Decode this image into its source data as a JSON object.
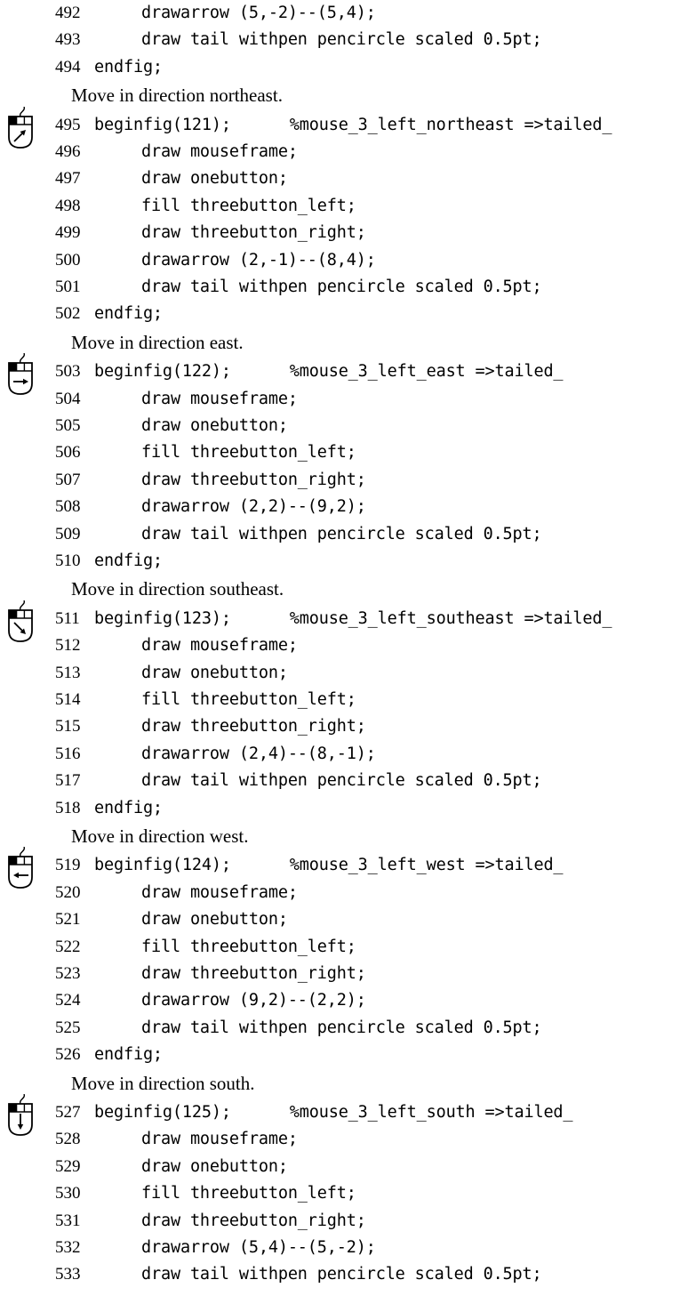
{
  "lead_lines": [
    {
      "num": "492",
      "text": "drawarrow (5,-2)--(5,4);",
      "indent": true
    },
    {
      "num": "493",
      "text": "draw tail withpen pencircle scaled 0.5pt;",
      "indent": true
    },
    {
      "num": "494",
      "text": "endfig;",
      "indent": false
    }
  ],
  "blocks": [
    {
      "caption": "Move in direction northeast.",
      "icon": "mouse-left-button-northeast-arrow-icon",
      "lines": [
        {
          "num": "495",
          "text": "beginfig(121);      %mouse_3_left_northeast =>tailed_",
          "indent": false
        },
        {
          "num": "496",
          "text": "draw mouseframe;",
          "indent": true
        },
        {
          "num": "497",
          "text": "draw onebutton;",
          "indent": true
        },
        {
          "num": "498",
          "text": "fill threebutton_left;",
          "indent": true
        },
        {
          "num": "499",
          "text": "draw threebutton_right;",
          "indent": true
        },
        {
          "num": "500",
          "text": "drawarrow (2,-1)--(8,4);",
          "indent": true
        },
        {
          "num": "501",
          "text": "draw tail withpen pencircle scaled 0.5pt;",
          "indent": true
        },
        {
          "num": "502",
          "text": "endfig;",
          "indent": false
        }
      ]
    },
    {
      "caption": "Move in direction east.",
      "icon": "mouse-left-button-east-arrow-icon",
      "lines": [
        {
          "num": "503",
          "text": "beginfig(122);      %mouse_3_left_east =>tailed_",
          "indent": false
        },
        {
          "num": "504",
          "text": "draw mouseframe;",
          "indent": true
        },
        {
          "num": "505",
          "text": "draw onebutton;",
          "indent": true
        },
        {
          "num": "506",
          "text": "fill threebutton_left;",
          "indent": true
        },
        {
          "num": "507",
          "text": "draw threebutton_right;",
          "indent": true
        },
        {
          "num": "508",
          "text": "drawarrow (2,2)--(9,2);",
          "indent": true
        },
        {
          "num": "509",
          "text": "draw tail withpen pencircle scaled 0.5pt;",
          "indent": true
        },
        {
          "num": "510",
          "text": "endfig;",
          "indent": false
        }
      ]
    },
    {
      "caption": "Move in direction southeast.",
      "icon": "mouse-left-button-southeast-arrow-icon",
      "lines": [
        {
          "num": "511",
          "text": "beginfig(123);      %mouse_3_left_southeast =>tailed_",
          "indent": false
        },
        {
          "num": "512",
          "text": "draw mouseframe;",
          "indent": true
        },
        {
          "num": "513",
          "text": "draw onebutton;",
          "indent": true
        },
        {
          "num": "514",
          "text": "fill threebutton_left;",
          "indent": true
        },
        {
          "num": "515",
          "text": "draw threebutton_right;",
          "indent": true
        },
        {
          "num": "516",
          "text": "drawarrow (2,4)--(8,-1);",
          "indent": true
        },
        {
          "num": "517",
          "text": "draw tail withpen pencircle scaled 0.5pt;",
          "indent": true
        },
        {
          "num": "518",
          "text": "endfig;",
          "indent": false
        }
      ]
    },
    {
      "caption": "Move in direction west.",
      "icon": "mouse-left-button-west-arrow-icon",
      "lines": [
        {
          "num": "519",
          "text": "beginfig(124);      %mouse_3_left_west =>tailed_",
          "indent": false
        },
        {
          "num": "520",
          "text": "draw mouseframe;",
          "indent": true
        },
        {
          "num": "521",
          "text": "draw onebutton;",
          "indent": true
        },
        {
          "num": "522",
          "text": "fill threebutton_left;",
          "indent": true
        },
        {
          "num": "523",
          "text": "draw threebutton_right;",
          "indent": true
        },
        {
          "num": "524",
          "text": "drawarrow (9,2)--(2,2);",
          "indent": true
        },
        {
          "num": "525",
          "text": "draw tail withpen pencircle scaled 0.5pt;",
          "indent": true
        },
        {
          "num": "526",
          "text": "endfig;",
          "indent": false
        }
      ]
    },
    {
      "caption": "Move in direction south.",
      "icon": "mouse-left-button-south-arrow-icon",
      "lines": [
        {
          "num": "527",
          "text": "beginfig(125);      %mouse_3_left_south =>tailed_",
          "indent": false
        },
        {
          "num": "528",
          "text": "draw mouseframe;",
          "indent": true
        },
        {
          "num": "529",
          "text": "draw onebutton;",
          "indent": true
        },
        {
          "num": "530",
          "text": "fill threebutton_left;",
          "indent": true
        },
        {
          "num": "531",
          "text": "draw threebutton_right;",
          "indent": true
        },
        {
          "num": "532",
          "text": "drawarrow (5,4)--(5,-2);",
          "indent": true
        },
        {
          "num": "533",
          "text": "draw tail withpen pencircle scaled 0.5pt;",
          "indent": true
        }
      ]
    }
  ]
}
